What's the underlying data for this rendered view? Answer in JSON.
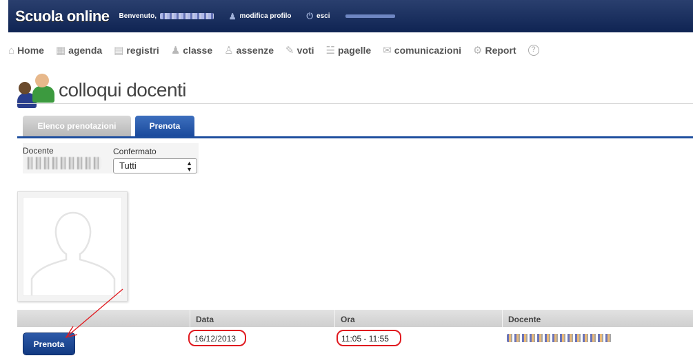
{
  "header": {
    "brand": "Scuola online",
    "welcome_prefix": "Benvenuto,",
    "profile_link": "modifica profilo",
    "logout_link": "esci"
  },
  "nav": {
    "items": [
      {
        "label": "Home",
        "icon": "home-icon"
      },
      {
        "label": "agenda",
        "icon": "calendar-icon"
      },
      {
        "label": "registri",
        "icon": "book-icon"
      },
      {
        "label": "classe",
        "icon": "users-icon"
      },
      {
        "label": "assenze",
        "icon": "user-icon"
      },
      {
        "label": "voti",
        "icon": "edit-icon"
      },
      {
        "label": "pagelle",
        "icon": "report-card-icon"
      },
      {
        "label": "comunicazioni",
        "icon": "mail-icon"
      },
      {
        "label": "Report",
        "icon": "gear-icon"
      }
    ],
    "help_icon": "help-icon"
  },
  "page": {
    "title": "colloqui docenti"
  },
  "tabs": [
    {
      "label": "Elenco prenotazioni",
      "active": false
    },
    {
      "label": "Prenota",
      "active": true
    }
  ],
  "filters": {
    "docente_label": "Docente",
    "confermato_label": "Confermato",
    "confermato_value": "Tutti"
  },
  "table": {
    "headers": [
      "",
      "Data",
      "Ora",
      "Docente"
    ],
    "rows": [
      {
        "action": "Prenota",
        "data": "16/12/2013",
        "ora": "11:05 - 11:55"
      }
    ]
  },
  "colors": {
    "header_bg": "#1a2f60",
    "tab_active": "#1e4e9e",
    "button": "#1f4a96",
    "highlight": "#e0191f"
  }
}
